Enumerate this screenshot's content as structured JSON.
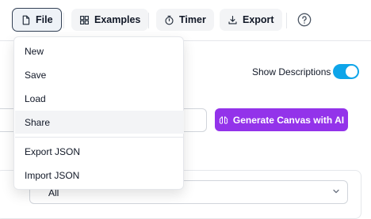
{
  "toolbar": {
    "file_label": "File",
    "examples_label": "Examples",
    "timer_label": "Timer",
    "export_label": "Export"
  },
  "file_menu": {
    "items": [
      {
        "label": "New"
      },
      {
        "label": "Save"
      },
      {
        "label": "Load"
      },
      {
        "label": "Share",
        "highlighted": true
      }
    ],
    "export_items": [
      {
        "label": "Export JSON"
      },
      {
        "label": "Import JSON"
      }
    ]
  },
  "settings": {
    "show_descriptions_label": "Show Descriptions",
    "show_descriptions_on": true
  },
  "generate": {
    "button_label": "Generate Canvas with AI"
  },
  "filter": {
    "selected_value": "All"
  },
  "colors": {
    "accent_purple": "#9333ea",
    "toggle_blue": "#0ea5e9"
  }
}
